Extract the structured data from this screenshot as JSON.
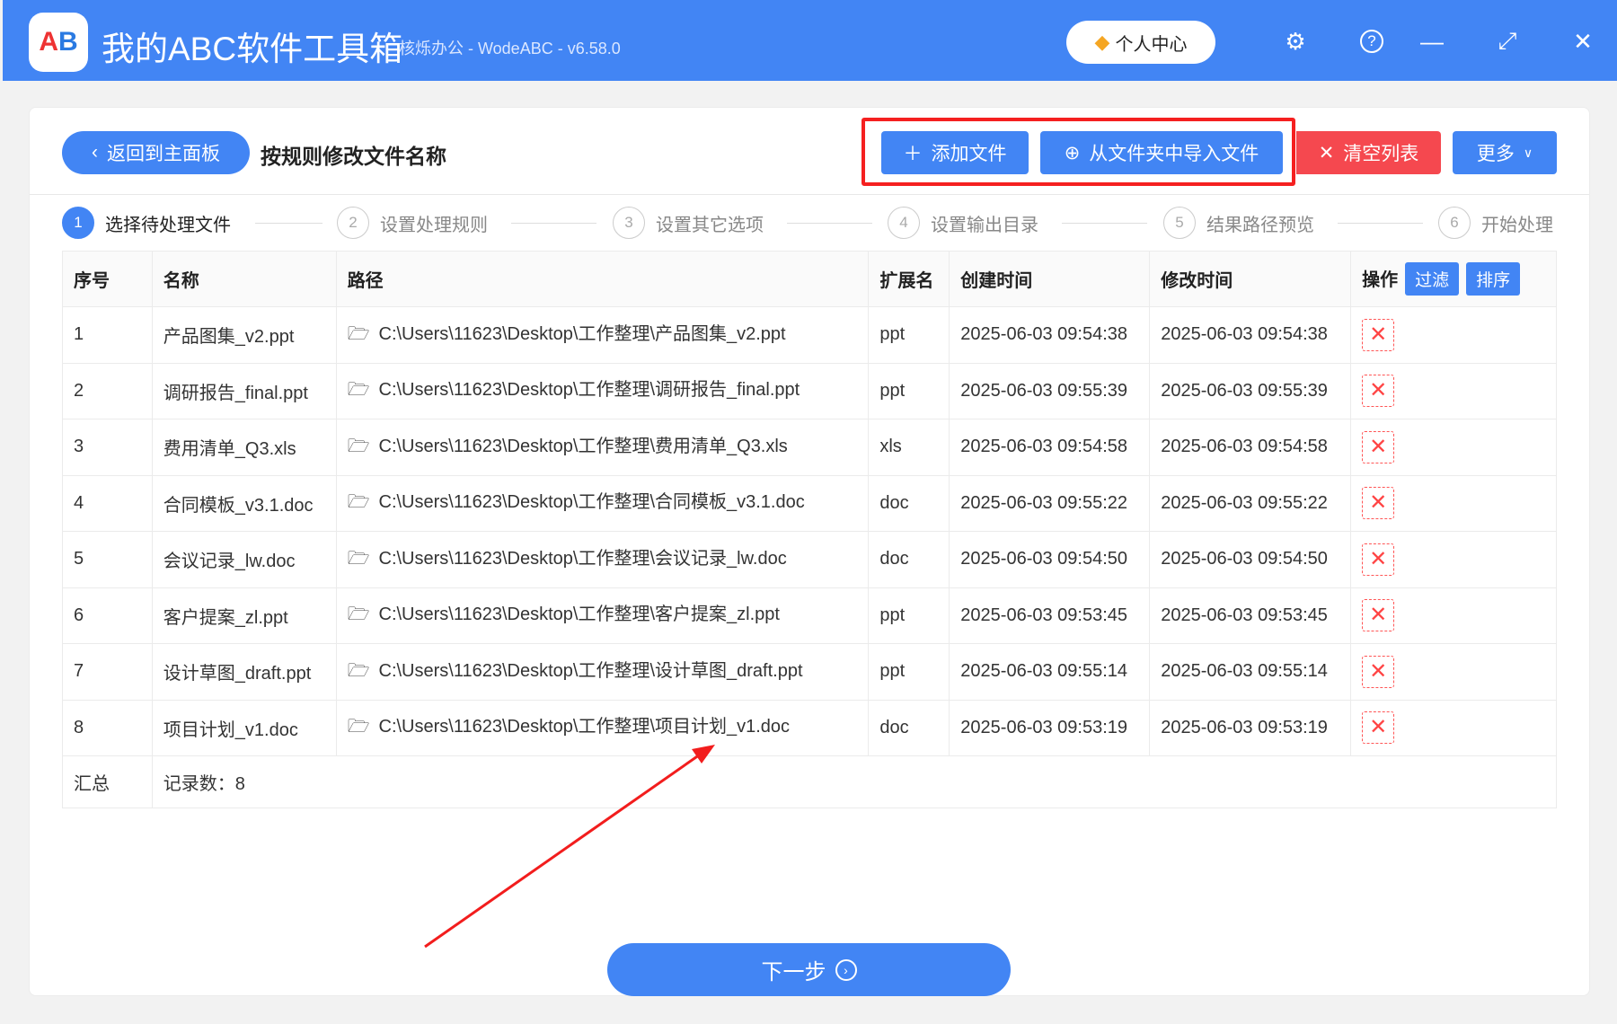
{
  "titlebar": {
    "logo": "AB",
    "title": "我的ABC软件工具箱",
    "subtitle": "核烁办公 - WodeABC - v6.58.0",
    "vip_label": "个人中心"
  },
  "toolbar": {
    "back_label": "返回到主面板",
    "heading": "按规则修改文件名称",
    "add_file": "添加文件",
    "import_folder": "从文件夹中导入文件",
    "clear_list": "清空列表",
    "more": "更多"
  },
  "steps": [
    {
      "n": "1",
      "label": "选择待处理文件"
    },
    {
      "n": "2",
      "label": "设置处理规则"
    },
    {
      "n": "3",
      "label": "设置其它选项"
    },
    {
      "n": "4",
      "label": "设置输出目录"
    },
    {
      "n": "5",
      "label": "结果路径预览"
    },
    {
      "n": "6",
      "label": "开始处理"
    }
  ],
  "table": {
    "headers": {
      "index": "序号",
      "name": "名称",
      "path": "路径",
      "ext": "扩展名",
      "created": "创建时间",
      "modified": "修改时间",
      "action": "操作",
      "filter": "过滤",
      "sort": "排序"
    },
    "rows": [
      {
        "index": "1",
        "name": "产品图集_v2.ppt",
        "path": "C:\\Users\\11623\\Desktop\\工作整理\\产品图集_v2.ppt",
        "ext": "ppt",
        "created": "2025-06-03 09:54:38",
        "modified": "2025-06-03 09:54:38"
      },
      {
        "index": "2",
        "name": "调研报告_final.ppt",
        "path": "C:\\Users\\11623\\Desktop\\工作整理\\调研报告_final.ppt",
        "ext": "ppt",
        "created": "2025-06-03 09:55:39",
        "modified": "2025-06-03 09:55:39"
      },
      {
        "index": "3",
        "name": "费用清单_Q3.xls",
        "path": "C:\\Users\\11623\\Desktop\\工作整理\\费用清单_Q3.xls",
        "ext": "xls",
        "created": "2025-06-03 09:54:58",
        "modified": "2025-06-03 09:54:58"
      },
      {
        "index": "4",
        "name": "合同模板_v3.1.doc",
        "path": "C:\\Users\\11623\\Desktop\\工作整理\\合同模板_v3.1.doc",
        "ext": "doc",
        "created": "2025-06-03 09:55:22",
        "modified": "2025-06-03 09:55:22"
      },
      {
        "index": "5",
        "name": "会议记录_lw.doc",
        "path": "C:\\Users\\11623\\Desktop\\工作整理\\会议记录_lw.doc",
        "ext": "doc",
        "created": "2025-06-03 09:54:50",
        "modified": "2025-06-03 09:54:50"
      },
      {
        "index": "6",
        "name": "客户提案_zl.ppt",
        "path": "C:\\Users\\11623\\Desktop\\工作整理\\客户提案_zl.ppt",
        "ext": "ppt",
        "created": "2025-06-03 09:53:45",
        "modified": "2025-06-03 09:53:45"
      },
      {
        "index": "7",
        "name": "设计草图_draft.ppt",
        "path": "C:\\Users\\11623\\Desktop\\工作整理\\设计草图_draft.ppt",
        "ext": "ppt",
        "created": "2025-06-03 09:55:14",
        "modified": "2025-06-03 09:55:14"
      },
      {
        "index": "8",
        "name": "项目计划_v1.doc",
        "path": "C:\\Users\\11623\\Desktop\\工作整理\\项目计划_v1.doc",
        "ext": "doc",
        "created": "2025-06-03 09:53:19",
        "modified": "2025-06-03 09:53:19"
      }
    ],
    "summary": {
      "label": "汇总",
      "count": "记录数：8"
    }
  },
  "next_label": "下一步",
  "colors": {
    "primary": "#4285f4",
    "danger": "#f5484f",
    "highlight": "#f52020"
  }
}
